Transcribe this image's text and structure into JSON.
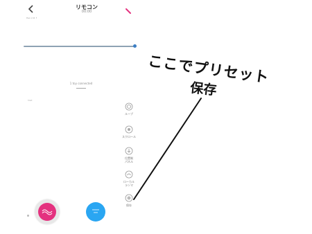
{
  "header": {
    "title": "リモコン",
    "subtitle": "00:00",
    "small_label": "Han 2 # ↑"
  },
  "slider": {
    "value": 1.0
  },
  "status": {
    "connected_text": "1 toy connected"
  },
  "section": {
    "label": "TAPI"
  },
  "tools": [
    {
      "icon": "wave-icon",
      "label": "ループ"
    },
    {
      "icon": "scroll-icon",
      "label": "スクロール"
    },
    {
      "icon": "touch-panel-icon",
      "label": "位置制\nパネル"
    },
    {
      "icon": "local-icon",
      "label": "ローカル\nランマ"
    },
    {
      "icon": "save-icon",
      "label": "保存"
    }
  ],
  "annotation": {
    "line1": "ここでプリセット",
    "line2": "保存"
  },
  "colors": {
    "accent_pink": "#e4327f",
    "accent_blue": "#2aa6f2",
    "slider_thumb": "#3d7fc4"
  }
}
